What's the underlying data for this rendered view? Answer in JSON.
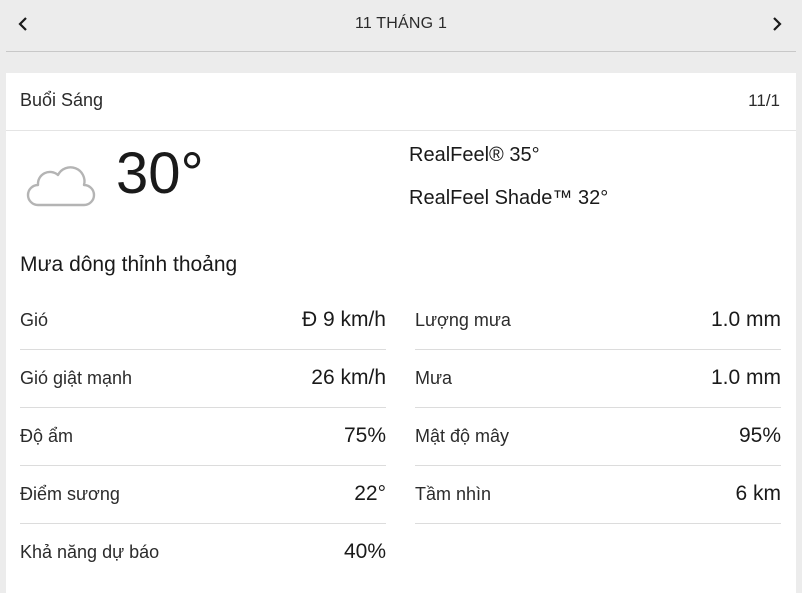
{
  "nav": {
    "title": "11 THÁNG 1",
    "prev_icon": "chevron-left-icon",
    "next_icon": "chevron-right-icon"
  },
  "card": {
    "period": "Buổi Sáng",
    "short_date": "11/1",
    "icon": "cloud-icon",
    "temperature": "30°",
    "realfeel": "RealFeel® 35°",
    "realfeel_shade": "RealFeel Shade™ 32°",
    "phrase": "Mưa dông thỉnh thoảng"
  },
  "details_left": [
    {
      "label": "Gió",
      "value": "Đ 9 km/h"
    },
    {
      "label": "Gió giật mạnh",
      "value": "26 km/h"
    },
    {
      "label": "Độ ẩm",
      "value": "75%"
    },
    {
      "label": "Điểm sương",
      "value": "22°"
    },
    {
      "label": "Khả năng dự báo",
      "value": "40%"
    }
  ],
  "details_right": [
    {
      "label": "Lượng mưa",
      "value": "1.0 mm"
    },
    {
      "label": "Mưa",
      "value": "1.0 mm"
    },
    {
      "label": "Mật độ mây",
      "value": "95%"
    },
    {
      "label": "Tầm nhìn",
      "value": "6 km"
    }
  ]
}
